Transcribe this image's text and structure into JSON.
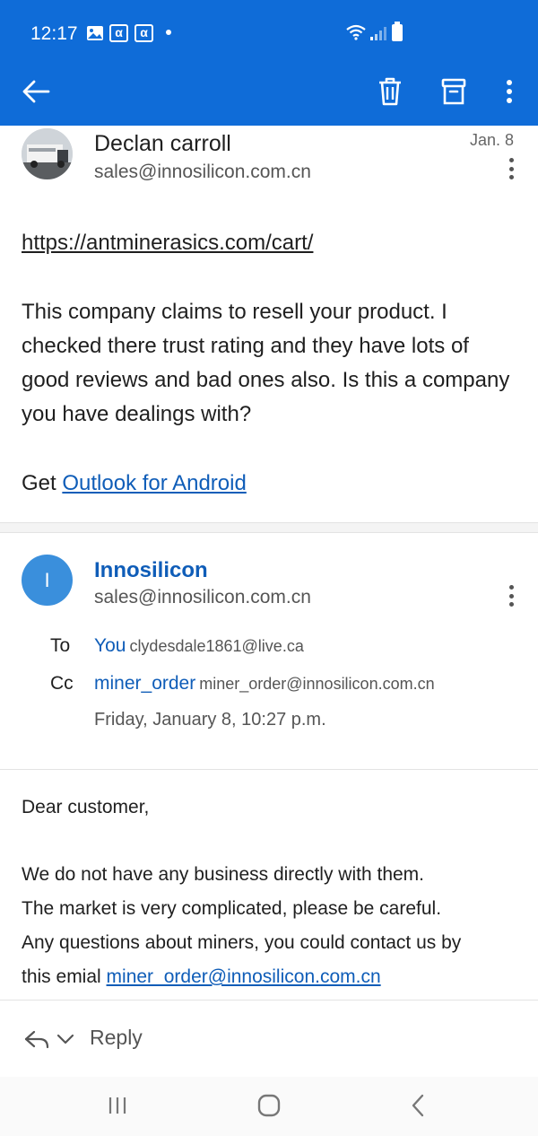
{
  "status_bar": {
    "time": "12:17",
    "icons": [
      "image-icon",
      "alpha-icon",
      "alpha-icon",
      "dot-icon",
      "wifi-icon",
      "signal-icon",
      "battery-icon"
    ],
    "alpha_glyph": "α"
  },
  "app_bar": {
    "icons": [
      "back-arrow-icon",
      "trash-icon",
      "archive-icon",
      "more-vertical-icon"
    ]
  },
  "message1": {
    "sender_name": "Declan carroll",
    "sender_email": "sales@innosilicon.com.cn",
    "date": "Jan. 8",
    "link": "https://antminerasics.com/cart/",
    "body": "This company claims to resell your product. I checked there trust rating and they have lots of good reviews and bad ones also. Is this a company you have dealings with?",
    "signature_prefix": "Get ",
    "signature_link": "Outlook for Android"
  },
  "message2": {
    "avatar_letter": "I",
    "sender_name": "Innosilicon",
    "sender_email": "sales@innosilicon.com.cn",
    "to_label": "To",
    "to_name": "You",
    "to_address": "clydesdale1861@live.ca",
    "cc_label": "Cc",
    "cc_name": "miner_order",
    "cc_address": "miner_order@innosilicon.com.cn",
    "sent_date": "Friday, January 8, 10:27 p.m.",
    "greeting": "Dear customer,",
    "line1": "We do not have any business directly with them.",
    "line2": "The market is very complicated, please be careful.",
    "line3": "Any questions about miners, you could contact us by",
    "line4_prefix": "this emial ",
    "line4_link": "miner_order@innosilicon.com.cn"
  },
  "reply_bar": {
    "label": "Reply",
    "icons": [
      "reply-arrow-icon",
      "chevron-down-icon"
    ]
  },
  "nav_bar": {
    "icons": [
      "recents-icon",
      "home-icon",
      "back-icon"
    ]
  },
  "colors": {
    "accent": "#0f6cd8",
    "link": "#0f5db8",
    "avatar": "#3a8fdc"
  }
}
